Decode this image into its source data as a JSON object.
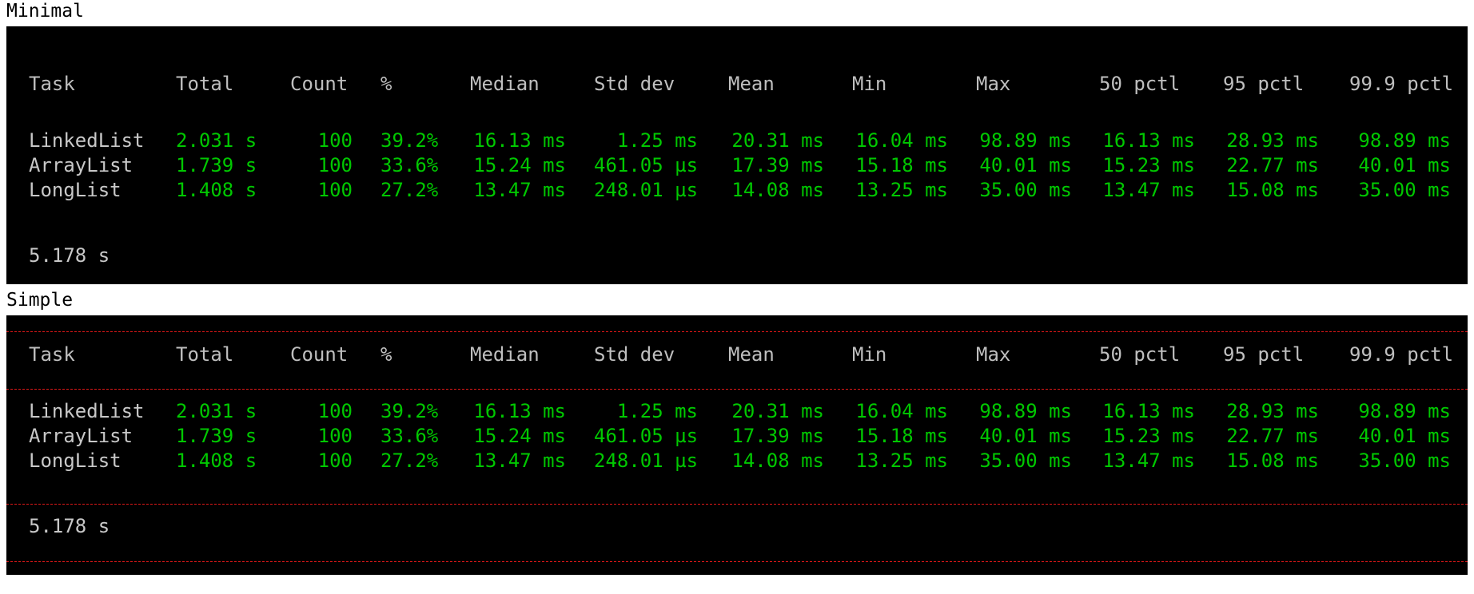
{
  "sections": [
    {
      "label": "Minimal",
      "style": "minimal",
      "headers": [
        "Task",
        "Total",
        "Count",
        "%",
        "Median",
        "Std dev",
        "Mean",
        "Min",
        "Max",
        "50 pctl",
        "95 pctl",
        "99.9 pctl"
      ],
      "rows": [
        [
          "LinkedList",
          "2.031 s",
          "100",
          "39.2%",
          "16.13 ms",
          "1.25 ms",
          "20.31 ms",
          "16.04 ms",
          "98.89 ms",
          "16.13 ms",
          "28.93 ms",
          "98.89 ms"
        ],
        [
          "ArrayList",
          "1.739 s",
          "100",
          "33.6%",
          "15.24 ms",
          "461.05 µs",
          "17.39 ms",
          "15.18 ms",
          "40.01 ms",
          "15.23 ms",
          "22.77 ms",
          "40.01 ms"
        ],
        [
          "LongList",
          "1.408 s",
          "100",
          "27.2%",
          "13.47 ms",
          "248.01 µs",
          "14.08 ms",
          "13.25 ms",
          "35.00 ms",
          "13.47 ms",
          "15.08 ms",
          "35.00 ms"
        ]
      ],
      "total": "5.178 s"
    },
    {
      "label": "Simple",
      "style": "simple",
      "headers": [
        "Task",
        "Total",
        "Count",
        "%",
        "Median",
        "Std dev",
        "Mean",
        "Min",
        "Max",
        "50 pctl",
        "95 pctl",
        "99.9 pctl"
      ],
      "rows": [
        [
          "LinkedList",
          "2.031 s",
          "100",
          "39.2%",
          "16.13 ms",
          "1.25 ms",
          "20.31 ms",
          "16.04 ms",
          "98.89 ms",
          "16.13 ms",
          "28.93 ms",
          "98.89 ms"
        ],
        [
          "ArrayList",
          "1.739 s",
          "100",
          "33.6%",
          "15.24 ms",
          "461.05 µs",
          "17.39 ms",
          "15.18 ms",
          "40.01 ms",
          "15.23 ms",
          "22.77 ms",
          "40.01 ms"
        ],
        [
          "LongList",
          "1.408 s",
          "100",
          "27.2%",
          "13.47 ms",
          "248.01 µs",
          "14.08 ms",
          "13.25 ms",
          "35.00 ms",
          "13.47 ms",
          "15.08 ms",
          "35.00 ms"
        ]
      ],
      "total": "5.178 s"
    }
  ],
  "colors": {
    "terminal_bg": "#000000",
    "header_text": "#bfbfbf",
    "task_text": "#c8c8c8",
    "value_text": "#00c800",
    "separator": "#e01818"
  }
}
